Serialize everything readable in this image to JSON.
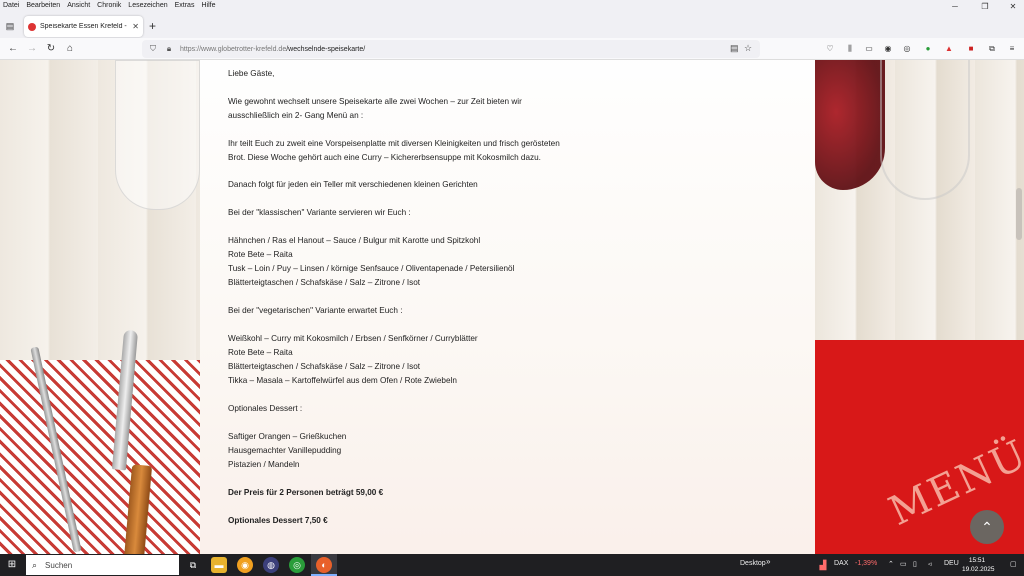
{
  "menubar": {
    "items": [
      "Datei",
      "Bearbeiten",
      "Ansicht",
      "Chronik",
      "Lesezeichen",
      "Extras",
      "Hilfe"
    ]
  },
  "tabs": [
    {
      "title": "Speisekarte Essen Krefeld - Glo",
      "active": true
    }
  ],
  "navbar": {
    "url_prefix": "https://www.globetrotter-krefeld.de",
    "url_path": "/wechselnde-speisekarte/"
  },
  "content": {
    "lines": [
      "Liebe Gäste,",
      "Wie gewohnt wechselt unsere Speisekarte alle zwei Wochen – zur Zeit bieten wir",
      "ausschließlich ein 2- Gang Menü an :",
      "Ihr teilt Euch zu zweit eine Vorspeisenplatte mit diversen Kleinigkeiten und frisch gerösteten",
      "Brot. Diese Woche gehört auch eine Curry – Kichererbsensuppe mit Kokosmilch dazu.",
      "Danach folgt für jeden ein Teller mit verschiedenen kleinen Gerichten",
      "Bei der \"klassischen\" Variante servieren wir Euch :",
      "Hähnchen / Ras el Hanout – Sauce / Bulgur mit Karotte und Spitzkohl",
      "Rote Bete – Raita",
      "Tusk – Loin / Puy – Linsen / körnige Senfsauce / Oliventapenade / Petersilienöl",
      "Blätterteigtaschen / Schafskäse / Salz – Zitrone / Isot",
      "Bei der \"vegetarischen\" Variante erwartet Euch :",
      "Weißkohl – Curry mit Kokosmilch / Erbsen / Senfkörner / Curryblätter",
      "Rote Bete – Raita",
      "Blätterteigtaschen / Schafskäse / Salz – Zitrone / Isot",
      "Tikka – Masala – Kartoffelwürfel aus dem Ofen / Rote Zwiebeln",
      "Optionales Dessert :",
      "Saftiger Orangen – Grießkuchen",
      "Hausgemachter Vanillepudding",
      "Pistazien / Mandeln",
      "Der Preis für 2 Personen beträgt  59,00 €",
      "Optionales Dessert  7,50 €"
    ]
  },
  "taskbar": {
    "search_placeholder": "Suchen",
    "desktop_label": "Desktop",
    "dax_label": "DAX",
    "dax_change": "-1,39%",
    "language": "DEU",
    "time": "15:51",
    "date": "19.02.2025"
  },
  "colors": {
    "menu_red": "#d81818",
    "dax_negative": "#ff6b6b"
  }
}
